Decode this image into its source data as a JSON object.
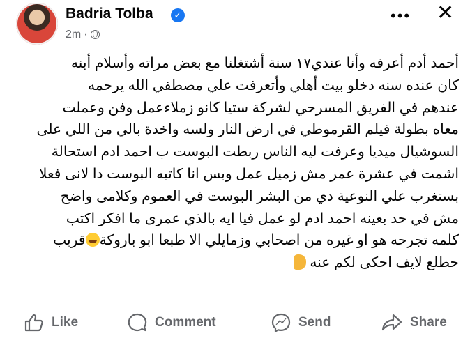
{
  "post": {
    "author": "Badria Tolba",
    "time": "2m",
    "separator": "·",
    "more_glyph": "•••",
    "close_glyph": "✕",
    "lines": [
      "أحمد أدم أعرفه وأنا عندي١٧ سنة أشتغلنا مع بعض مراته وأسلام أبنه",
      "كان عنده سنه دخلو بيت أهلي وأتعرفت علي مصطفي الله يرحمه",
      "عندهم في الفريق المسرحي لشركة ستيا كانو زملاءعمل وفن وعملت",
      "معاه بطولة فيلم القرموطي في ارض النار ولسه واخدة بالي من اللي على",
      "السوشيال ميديا وعرفت ليه الناس ربطت البوست ب احمد ادم استحالة",
      "اشمت في عشرة عمر مش زميل عمل وبس انا كاتبه البوست دا لانى فعلا",
      "بستغرب علي النوعية دي من البشر البوست في العموم وكلامى واضح",
      "مش في حد بعينه احمد ادم لو عمل فيا ايه بالذي عمرى ما افكر اكتب",
      "كلمه تجرحه هو او غيره من اصحابي وزمايلي الا طبعا ابو باروكة",
      "قريب",
      "حطلع لايف احكى لكم عنه"
    ]
  },
  "icons": {
    "verified": "verified-badge-icon",
    "audience": "globe-icon",
    "laugh": "tears-of-joy-emoji",
    "hand": "hand-emoji",
    "like": "thumbs-up-icon",
    "comment": "comment-bubble-icon",
    "send": "messenger-icon",
    "share": "share-arrow-icon"
  },
  "actions": {
    "like": "Like",
    "comment": "Comment",
    "send": "Send",
    "share": "Share"
  },
  "colors": {
    "verified": "#1877f2",
    "secondary_text": "#65676b",
    "text": "#050505"
  }
}
